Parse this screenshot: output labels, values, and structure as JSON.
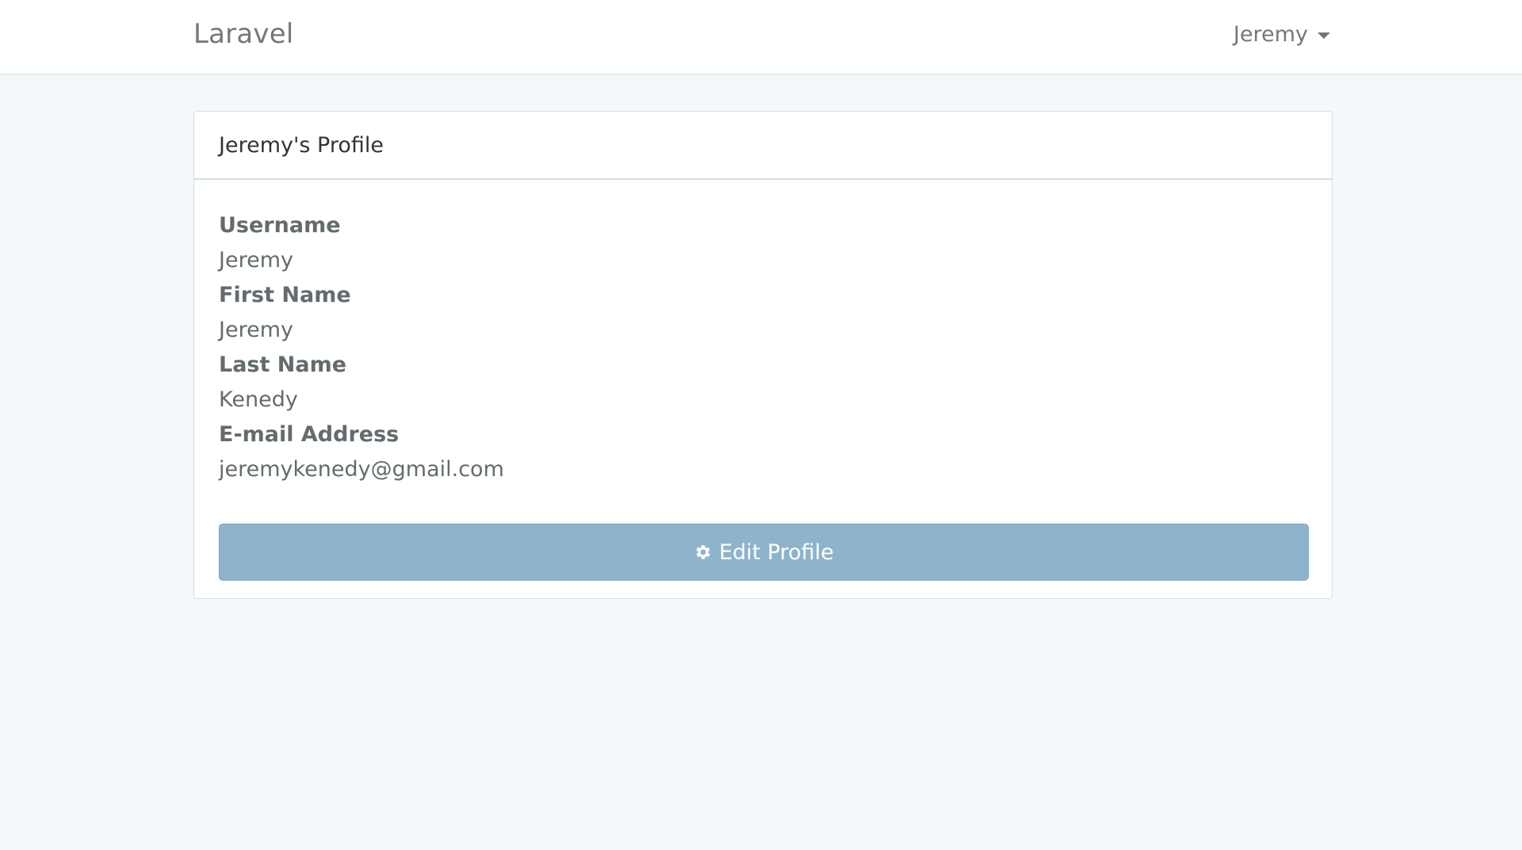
{
  "navbar": {
    "brand": "Laravel",
    "user_name": "Jeremy"
  },
  "panel": {
    "title": "Jeremy's Profile",
    "fields": [
      {
        "label": "Username",
        "value": "Jeremy"
      },
      {
        "label": "First Name",
        "value": "Jeremy"
      },
      {
        "label": "Last Name",
        "value": "Kenedy"
      },
      {
        "label": "E-mail Address",
        "value": "jeremykenedy@gmail.com"
      }
    ],
    "edit_button_label": "Edit Profile",
    "edit_button_icon": "gear-icon"
  },
  "colors": {
    "page_background": "#f4f8fb",
    "button_background": "#8eb4cb",
    "border": "#d3e0e9"
  }
}
